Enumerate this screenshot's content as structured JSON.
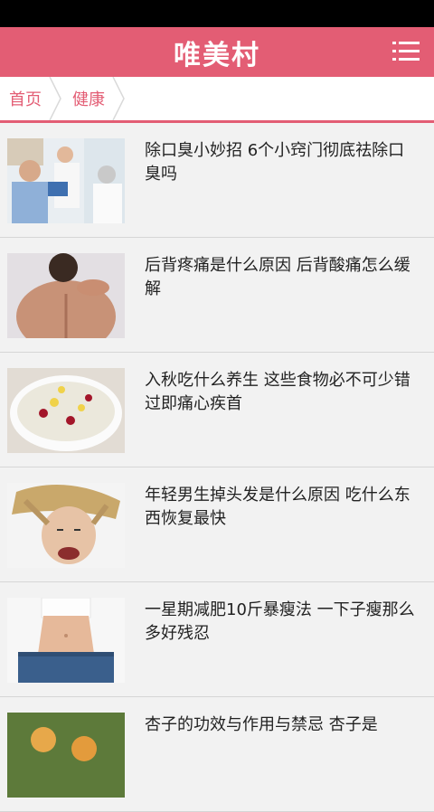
{
  "app": {
    "title": "唯美村",
    "menu_icon": "menu-icon"
  },
  "breadcrumb": [
    "首页",
    "健康"
  ],
  "colors": {
    "brand": "#e35d74",
    "background": "#f2f2f2"
  },
  "articles": [
    {
      "title": "除口臭小妙招 6个小窍门彻底祛除口臭吗"
    },
    {
      "title": "后背疼痛是什么原因 后背酸痛怎么缓解"
    },
    {
      "title": "入秋吃什么养生 这些食物必不可少错过即痛心疾首"
    },
    {
      "title": "年轻男生掉头发是什么原因 吃什么东西恢复最快"
    },
    {
      "title": "一星期减肥10斤暴瘦法 一下子瘦那么多好残忍"
    },
    {
      "title": "杏子的功效与作用与禁忌 杏子是"
    }
  ]
}
